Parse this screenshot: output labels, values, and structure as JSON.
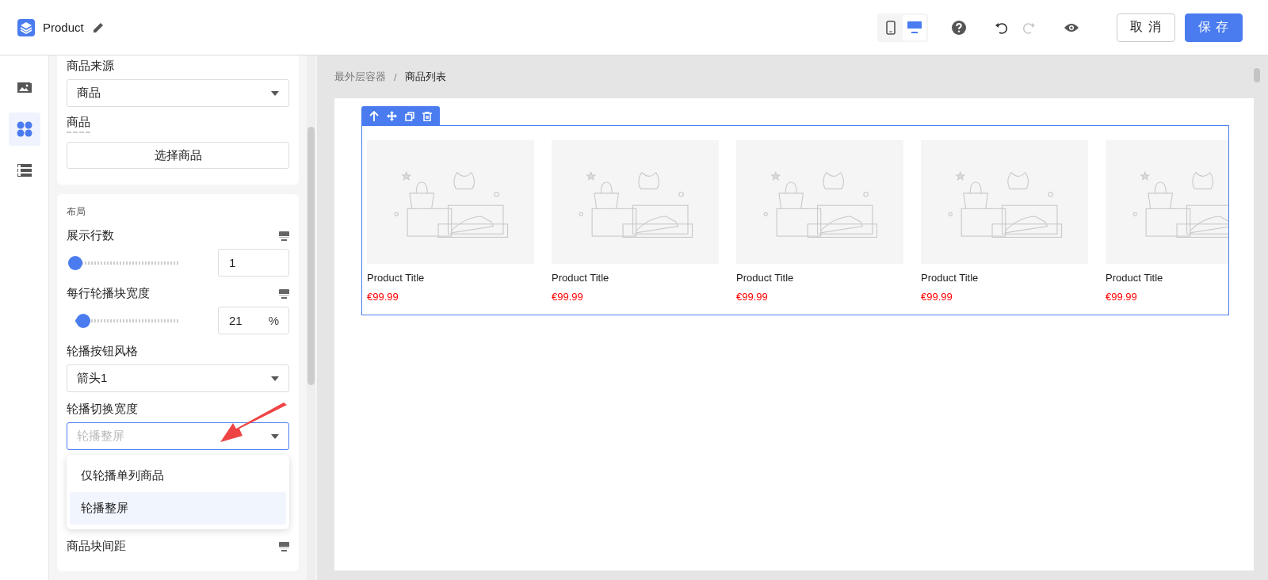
{
  "header": {
    "title": "Product",
    "device_toggle": [
      {
        "kind": "mobile",
        "selected": false
      },
      {
        "kind": "desktop",
        "selected": true
      }
    ],
    "redo_disabled": true,
    "buttons": [
      {
        "kind": "secondary",
        "label": "取 消"
      },
      {
        "kind": "primary",
        "label": "保 存"
      }
    ]
  },
  "rail": [
    {
      "kind": "image",
      "selected": false
    },
    {
      "kind": "widgets",
      "selected": true
    },
    {
      "kind": "list",
      "selected": false
    }
  ],
  "source_card": {
    "items": [
      {
        "kind": "select",
        "label": "商品来源",
        "value": "商品"
      },
      {
        "kind": "button",
        "label": "商品",
        "value": "选择商品"
      }
    ]
  },
  "layout_card": {
    "title": "布局",
    "items": [
      {
        "kind": "slider",
        "label": "展示行数",
        "level": 0.0,
        "value": "1"
      },
      {
        "kind": "slider",
        "label": "每行轮播块宽度",
        "level": 0.08,
        "value": "21",
        "unit": "%"
      },
      {
        "kind": "select",
        "label": "轮播按钮风格",
        "value": "箭头1"
      },
      {
        "kind": "select",
        "label": "轮播切换宽度",
        "placeholder": "轮播整屏",
        "open": true,
        "options": [
          {
            "label": "仅轮播单列商品",
            "selected": false
          },
          {
            "label": "轮播整屏",
            "selected": true
          }
        ]
      },
      {
        "kind": "heading",
        "label": "商品块间距"
      }
    ]
  },
  "breadcrumb": [
    "最外层容器",
    "商品列表"
  ],
  "breadcrumb_separator": "/",
  "products": [
    {
      "title": "Product Title",
      "price": "€99.99"
    },
    {
      "title": "Product Title",
      "price": "€99.99"
    },
    {
      "title": "Product Title",
      "price": "€99.99"
    },
    {
      "title": "Product Title",
      "price": "€99.99"
    },
    {
      "title": "Product Title",
      "price": "€99.99"
    }
  ]
}
